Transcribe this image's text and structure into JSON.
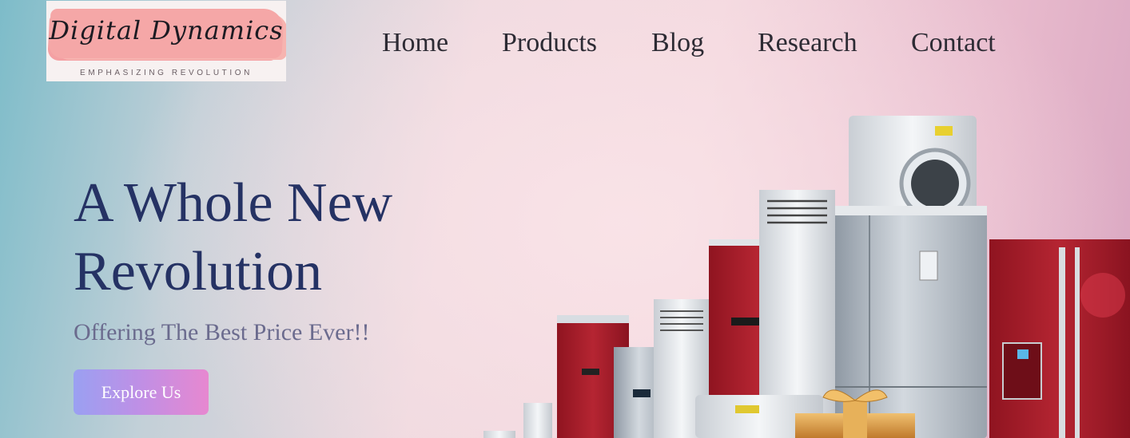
{
  "logo": {
    "title": "Digital Dynamics",
    "tagline": "EMPHASIZING REVOLUTION"
  },
  "nav": {
    "items": [
      {
        "label": "Home"
      },
      {
        "label": "Products"
      },
      {
        "label": "Blog"
      },
      {
        "label": "Research"
      },
      {
        "label": "Contact"
      }
    ]
  },
  "hero": {
    "title_line1": "A Whole New",
    "title_line2": "Revolution",
    "subtitle": "Offering The Best Price Ever!!",
    "cta_label": "Explore Us"
  },
  "colors": {
    "title": "#253264",
    "subtitle": "#6b6b8e",
    "cta_gradient_start": "#9aa0f2",
    "cta_gradient_end": "#e788d0",
    "appliance_red": "#a81f2a",
    "appliance_silver": "#b8c0c8"
  }
}
